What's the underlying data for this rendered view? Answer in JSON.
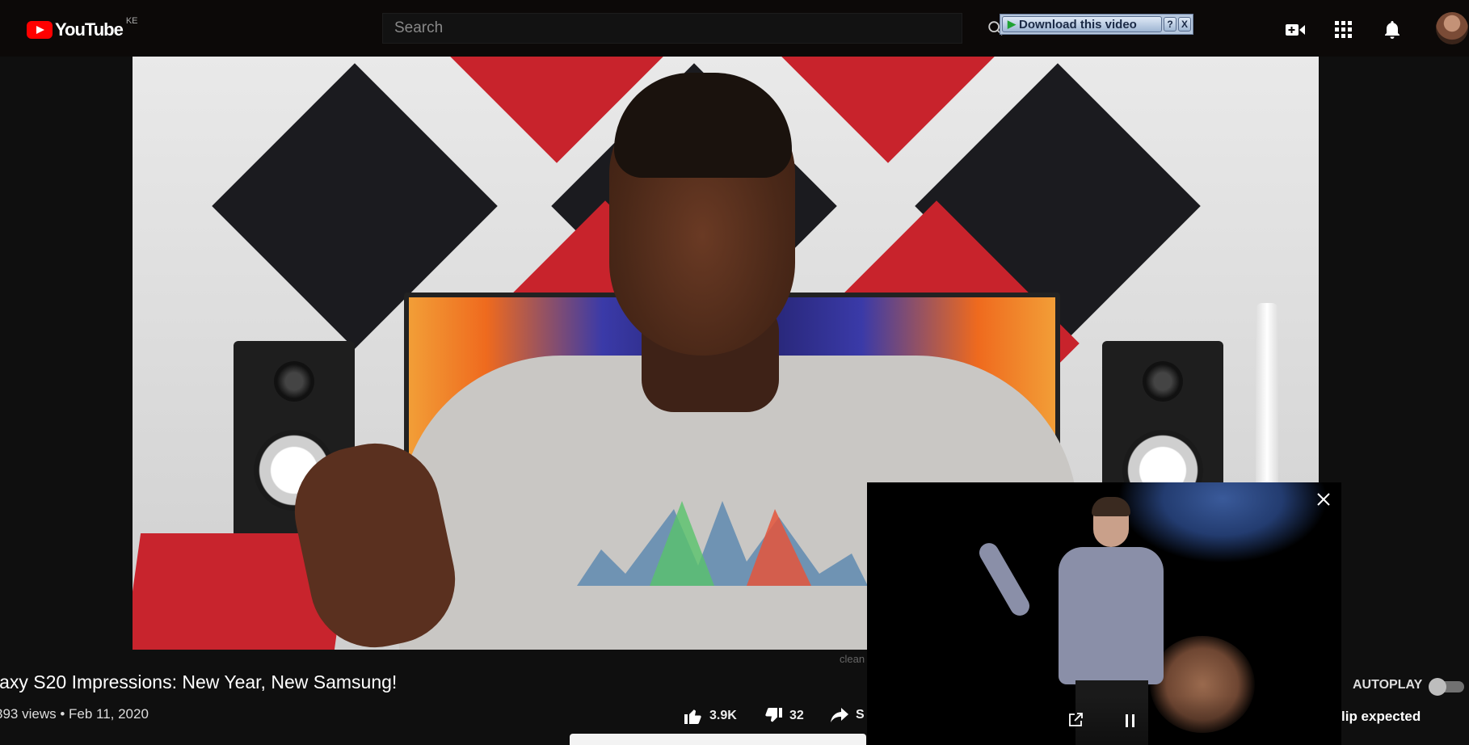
{
  "header": {
    "logo_text": "YouTube",
    "country_code": "KE",
    "search_placeholder": "Search",
    "download_bar": {
      "button_label": "Download this video",
      "help_label": "?",
      "close_label": "X"
    },
    "icons": [
      "create-video-icon",
      "apps-grid-icon",
      "notifications-bell-icon",
      "account-avatar"
    ]
  },
  "video": {
    "title": "laxy S20 Impressions: New Year, New Samsung!",
    "meta": "393 views • Feb 11, 2020",
    "watermark": "clean",
    "actions": {
      "like_count": "3.9K",
      "dislike_count": "32",
      "share_label": "S"
    }
  },
  "sidebar": {
    "autoplay_label": "AUTOPLAY",
    "autoplay_on": false,
    "up_next_fragment": "lip expected"
  },
  "miniplayer": {
    "icons": [
      "close-icon",
      "popout-icon",
      "pause-icon"
    ]
  },
  "colors": {
    "background": "#0f0f0f",
    "youtube_red": "#ff0000",
    "download_bar": "#b5c6dc"
  }
}
